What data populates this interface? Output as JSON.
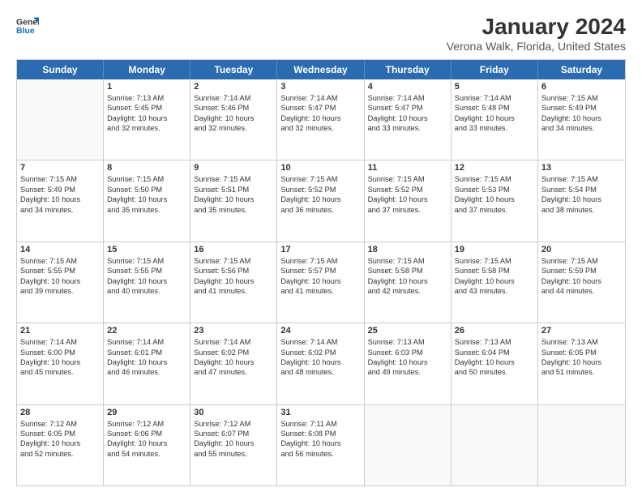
{
  "logo": {
    "line1": "General",
    "line2": "Blue"
  },
  "title": "January 2024",
  "subtitle": "Verona Walk, Florida, United States",
  "header_days": [
    "Sunday",
    "Monday",
    "Tuesday",
    "Wednesday",
    "Thursday",
    "Friday",
    "Saturday"
  ],
  "weeks": [
    [
      {
        "day": "",
        "lines": []
      },
      {
        "day": "1",
        "lines": [
          "Sunrise: 7:13 AM",
          "Sunset: 5:45 PM",
          "Daylight: 10 hours",
          "and 32 minutes."
        ]
      },
      {
        "day": "2",
        "lines": [
          "Sunrise: 7:14 AM",
          "Sunset: 5:46 PM",
          "Daylight: 10 hours",
          "and 32 minutes."
        ]
      },
      {
        "day": "3",
        "lines": [
          "Sunrise: 7:14 AM",
          "Sunset: 5:47 PM",
          "Daylight: 10 hours",
          "and 32 minutes."
        ]
      },
      {
        "day": "4",
        "lines": [
          "Sunrise: 7:14 AM",
          "Sunset: 5:47 PM",
          "Daylight: 10 hours",
          "and 33 minutes."
        ]
      },
      {
        "day": "5",
        "lines": [
          "Sunrise: 7:14 AM",
          "Sunset: 5:48 PM",
          "Daylight: 10 hours",
          "and 33 minutes."
        ]
      },
      {
        "day": "6",
        "lines": [
          "Sunrise: 7:15 AM",
          "Sunset: 5:49 PM",
          "Daylight: 10 hours",
          "and 34 minutes."
        ]
      }
    ],
    [
      {
        "day": "7",
        "lines": [
          "Sunrise: 7:15 AM",
          "Sunset: 5:49 PM",
          "Daylight: 10 hours",
          "and 34 minutes."
        ]
      },
      {
        "day": "8",
        "lines": [
          "Sunrise: 7:15 AM",
          "Sunset: 5:50 PM",
          "Daylight: 10 hours",
          "and 35 minutes."
        ]
      },
      {
        "day": "9",
        "lines": [
          "Sunrise: 7:15 AM",
          "Sunset: 5:51 PM",
          "Daylight: 10 hours",
          "and 35 minutes."
        ]
      },
      {
        "day": "10",
        "lines": [
          "Sunrise: 7:15 AM",
          "Sunset: 5:52 PM",
          "Daylight: 10 hours",
          "and 36 minutes."
        ]
      },
      {
        "day": "11",
        "lines": [
          "Sunrise: 7:15 AM",
          "Sunset: 5:52 PM",
          "Daylight: 10 hours",
          "and 37 minutes."
        ]
      },
      {
        "day": "12",
        "lines": [
          "Sunrise: 7:15 AM",
          "Sunset: 5:53 PM",
          "Daylight: 10 hours",
          "and 37 minutes."
        ]
      },
      {
        "day": "13",
        "lines": [
          "Sunrise: 7:15 AM",
          "Sunset: 5:54 PM",
          "Daylight: 10 hours",
          "and 38 minutes."
        ]
      }
    ],
    [
      {
        "day": "14",
        "lines": [
          "Sunrise: 7:15 AM",
          "Sunset: 5:55 PM",
          "Daylight: 10 hours",
          "and 39 minutes."
        ]
      },
      {
        "day": "15",
        "lines": [
          "Sunrise: 7:15 AM",
          "Sunset: 5:55 PM",
          "Daylight: 10 hours",
          "and 40 minutes."
        ]
      },
      {
        "day": "16",
        "lines": [
          "Sunrise: 7:15 AM",
          "Sunset: 5:56 PM",
          "Daylight: 10 hours",
          "and 41 minutes."
        ]
      },
      {
        "day": "17",
        "lines": [
          "Sunrise: 7:15 AM",
          "Sunset: 5:57 PM",
          "Daylight: 10 hours",
          "and 41 minutes."
        ]
      },
      {
        "day": "18",
        "lines": [
          "Sunrise: 7:15 AM",
          "Sunset: 5:58 PM",
          "Daylight: 10 hours",
          "and 42 minutes."
        ]
      },
      {
        "day": "19",
        "lines": [
          "Sunrise: 7:15 AM",
          "Sunset: 5:58 PM",
          "Daylight: 10 hours",
          "and 43 minutes."
        ]
      },
      {
        "day": "20",
        "lines": [
          "Sunrise: 7:15 AM",
          "Sunset: 5:59 PM",
          "Daylight: 10 hours",
          "and 44 minutes."
        ]
      }
    ],
    [
      {
        "day": "21",
        "lines": [
          "Sunrise: 7:14 AM",
          "Sunset: 6:00 PM",
          "Daylight: 10 hours",
          "and 45 minutes."
        ]
      },
      {
        "day": "22",
        "lines": [
          "Sunrise: 7:14 AM",
          "Sunset: 6:01 PM",
          "Daylight: 10 hours",
          "and 46 minutes."
        ]
      },
      {
        "day": "23",
        "lines": [
          "Sunrise: 7:14 AM",
          "Sunset: 6:02 PM",
          "Daylight: 10 hours",
          "and 47 minutes."
        ]
      },
      {
        "day": "24",
        "lines": [
          "Sunrise: 7:14 AM",
          "Sunset: 6:02 PM",
          "Daylight: 10 hours",
          "and 48 minutes."
        ]
      },
      {
        "day": "25",
        "lines": [
          "Sunrise: 7:13 AM",
          "Sunset: 6:03 PM",
          "Daylight: 10 hours",
          "and 49 minutes."
        ]
      },
      {
        "day": "26",
        "lines": [
          "Sunrise: 7:13 AM",
          "Sunset: 6:04 PM",
          "Daylight: 10 hours",
          "and 50 minutes."
        ]
      },
      {
        "day": "27",
        "lines": [
          "Sunrise: 7:13 AM",
          "Sunset: 6:05 PM",
          "Daylight: 10 hours",
          "and 51 minutes."
        ]
      }
    ],
    [
      {
        "day": "28",
        "lines": [
          "Sunrise: 7:12 AM",
          "Sunset: 6:05 PM",
          "Daylight: 10 hours",
          "and 52 minutes."
        ]
      },
      {
        "day": "29",
        "lines": [
          "Sunrise: 7:12 AM",
          "Sunset: 6:06 PM",
          "Daylight: 10 hours",
          "and 54 minutes."
        ]
      },
      {
        "day": "30",
        "lines": [
          "Sunrise: 7:12 AM",
          "Sunset: 6:07 PM",
          "Daylight: 10 hours",
          "and 55 minutes."
        ]
      },
      {
        "day": "31",
        "lines": [
          "Sunrise: 7:11 AM",
          "Sunset: 6:08 PM",
          "Daylight: 10 hours",
          "and 56 minutes."
        ]
      },
      {
        "day": "",
        "lines": []
      },
      {
        "day": "",
        "lines": []
      },
      {
        "day": "",
        "lines": []
      }
    ]
  ]
}
